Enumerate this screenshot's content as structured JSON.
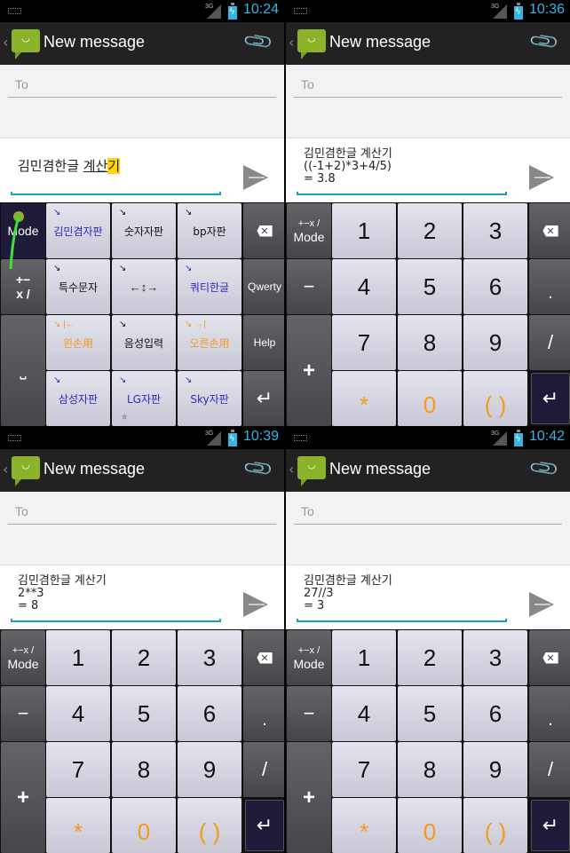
{
  "colors": {
    "accent": "#33b5e5",
    "underline": "#1a9fbf",
    "orange": "#f39a1d",
    "blue": "#2a2ac0",
    "highlight": "#ffd700",
    "app_green": "#8ab32a"
  },
  "common": {
    "title": "New message",
    "to_placeholder": "To",
    "network": "3G",
    "face": "◡"
  },
  "screens": [
    {
      "time": "10:24",
      "msg_prefix": "김민겸한글 ",
      "msg_underlined": "계산",
      "msg_highlight": "기"
    },
    {
      "time": "10:36",
      "message": "김민겸한글 계산기\n((-1+2)*3+4/5)\n= 3.8"
    },
    {
      "time": "10:39",
      "message": "김민겸한글 계산기\n2**3\n= 8"
    },
    {
      "time": "10:42",
      "message": "김민겸한글 계산기\n27//3\n= 3"
    }
  ],
  "mode_keyboard": {
    "mode": "Mode",
    "ops": "+−\nx /",
    "space": "⎵",
    "qwerty": "Qwerty",
    "help": "Help",
    "backspace": "✕",
    "enter": "↵",
    "hint_arrow": "↘",
    "keys": [
      {
        "label": "김민겸자판",
        "color": "blue"
      },
      {
        "label": "숫자자판",
        "color": "dark"
      },
      {
        "label": "bp자판",
        "color": "dark"
      },
      {
        "label": "특수문자",
        "color": "dark"
      },
      {
        "label": "←↕→",
        "color": "dark"
      },
      {
        "label": "쿼티한글",
        "color": "blue"
      },
      {
        "label": "왼손用",
        "color": "orange",
        "hint": "↘ |←"
      },
      {
        "label": "음성입력",
        "color": "dark"
      },
      {
        "label": "오른손用",
        "color": "orange",
        "hint": "↘ →|"
      },
      {
        "label": "삼성자판",
        "color": "blue"
      },
      {
        "label": "LG자판",
        "color": "blue",
        "sub": "ㅎ"
      },
      {
        "label": "Sky자판",
        "color": "blue"
      }
    ]
  },
  "num_keyboard": {
    "mode_top": "+−x /",
    "mode_bottom": "Mode",
    "minus": "−",
    "plus": "+",
    "dot": ".",
    "slash": "/",
    "backspace": "✕",
    "enter": "↵",
    "digits": [
      "1",
      "2",
      "3",
      "4",
      "5",
      "6",
      "7",
      "8",
      "9"
    ],
    "bottom": [
      "*",
      "0",
      "( )"
    ]
  }
}
